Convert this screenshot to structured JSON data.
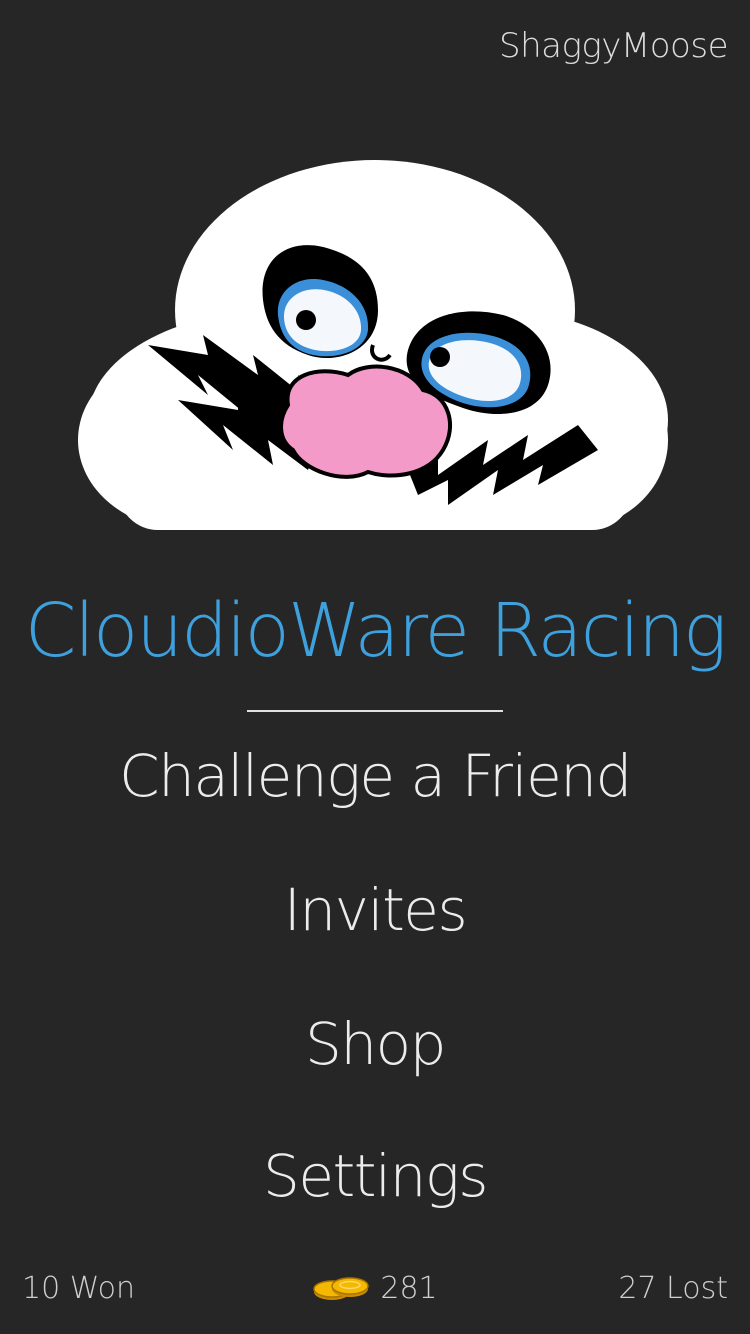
{
  "header": {
    "username": "ShaggyMoose"
  },
  "logo": {
    "icon": "wario-cloud-logo",
    "cloud_color": "#ffffff",
    "mustache_color": "#000000",
    "nose_color": "#f49ac8",
    "eye_accent_color": "#3a8fd8"
  },
  "app": {
    "title": "CloudioWare Racing",
    "title_color": "#3ea0dc"
  },
  "menu": {
    "challenge_label": "Challenge a Friend",
    "invites_label": "Invites",
    "shop_label": "Shop",
    "settings_label": "Settings"
  },
  "footer": {
    "won_label": "10 Won",
    "coins_icon": "coins-icon",
    "coins_value": "281",
    "lost_label": "27 Lost"
  },
  "colors": {
    "background": "#262626",
    "text": "#ececec",
    "coin": "#f5b800"
  }
}
